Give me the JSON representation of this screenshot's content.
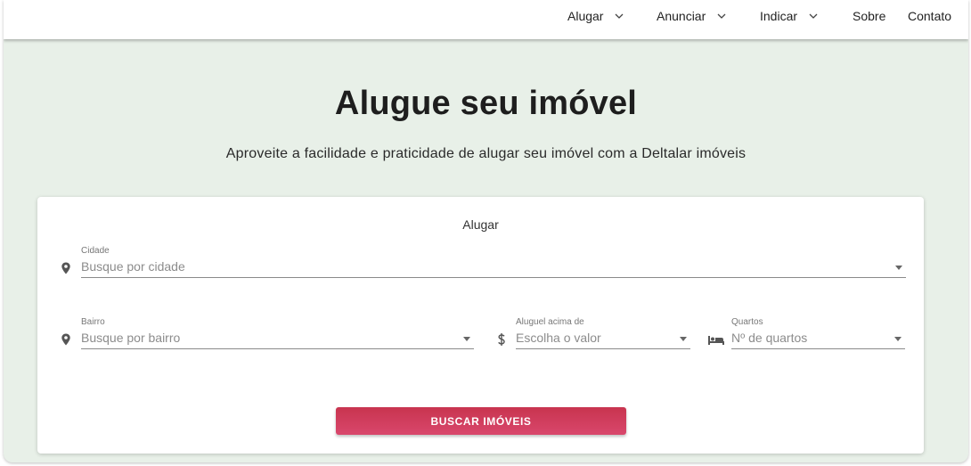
{
  "nav": {
    "items": [
      {
        "label": "Alugar",
        "has_dropdown": true
      },
      {
        "label": "Anunciar",
        "has_dropdown": true
      },
      {
        "label": "Indicar",
        "has_dropdown": true
      },
      {
        "label": "Sobre",
        "has_dropdown": false
      },
      {
        "label": "Contato",
        "has_dropdown": false
      }
    ]
  },
  "hero": {
    "title": "Alugue seu imóvel",
    "subtitle": "Aproveite a facilidade e praticidade de alugar seu imóvel com a Deltalar imóveis"
  },
  "search_card": {
    "title": "Alugar",
    "fields": {
      "cidade": {
        "label": "Cidade",
        "placeholder": "Busque por cidade",
        "icon": "location-pin-icon"
      },
      "bairro": {
        "label": "Bairro",
        "placeholder": "Busque por bairro",
        "icon": "location-pin-icon"
      },
      "aluguel": {
        "label": "Aluguel acima de",
        "placeholder": "Escolha o valor",
        "icon": "dollar-icon"
      },
      "quartos": {
        "label": "Quartos",
        "placeholder": "Nº de quartos",
        "icon": "bed-icon"
      }
    },
    "submit_label": "BUSCAR IMÓVEIS"
  },
  "colors": {
    "background": "#e8f0e8",
    "navbar": "#ffffff",
    "accent": "#d03d5c",
    "text": "#1e1e1e"
  }
}
